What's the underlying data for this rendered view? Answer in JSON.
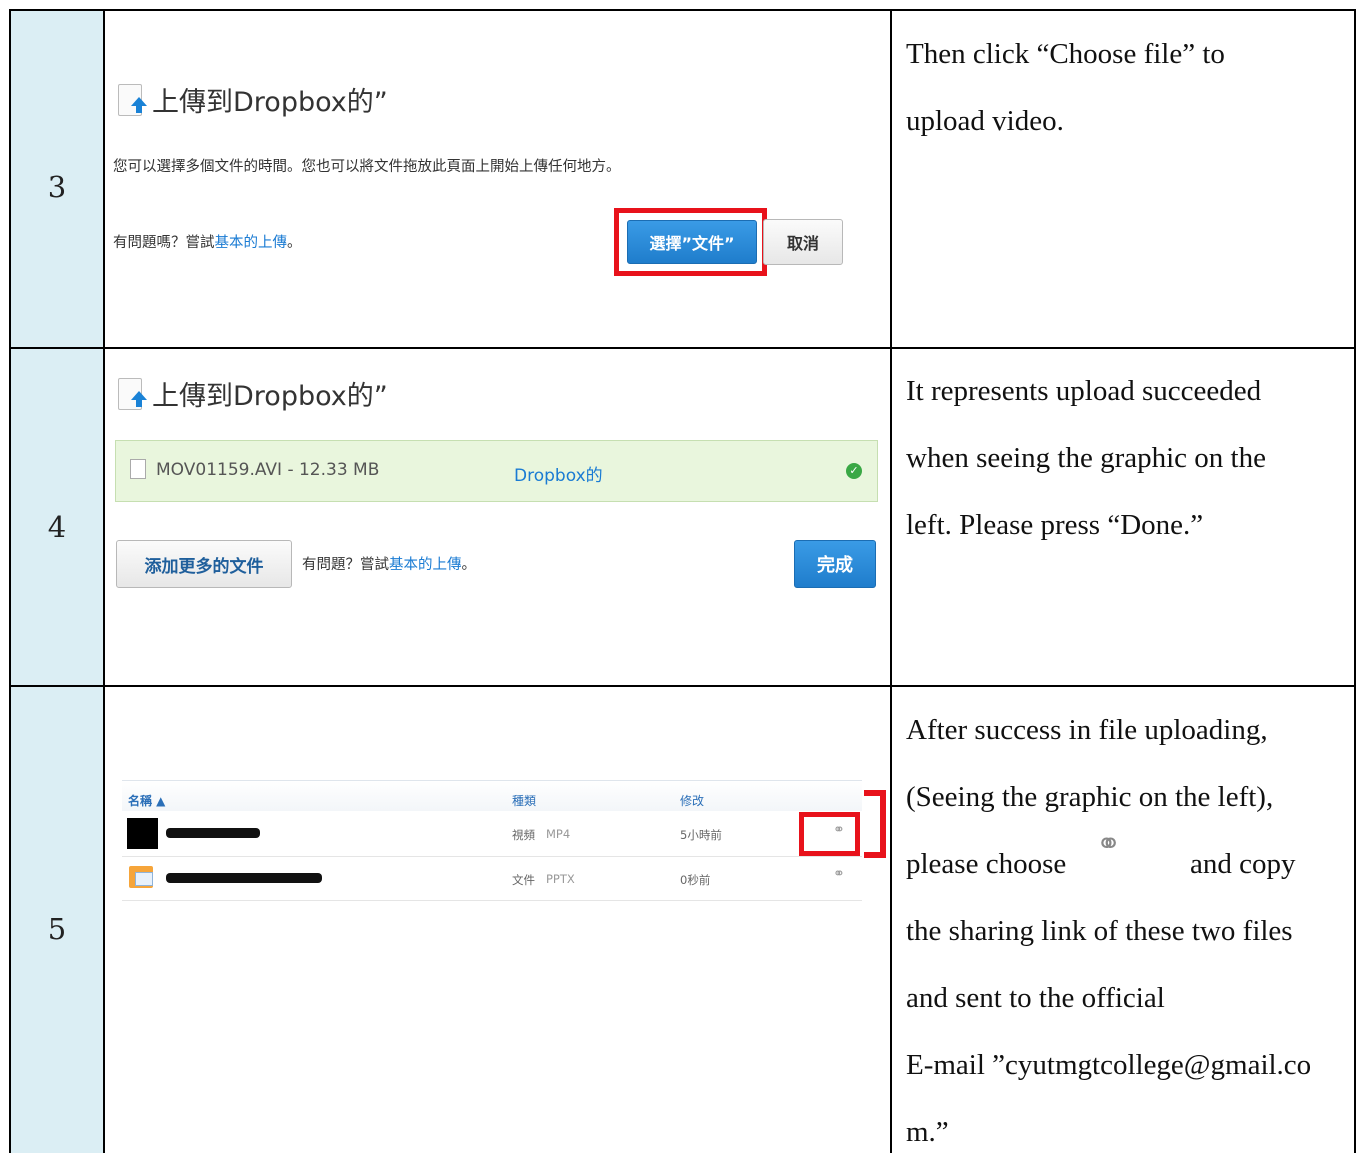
{
  "rows": [
    {
      "step": "3",
      "description": [
        "Then click “Choose file” to",
        "upload video."
      ],
      "dialog": {
        "title": "上傳到Dropbox的”",
        "message": "您可以選擇多個文件的時間。您也可以將文件拖放此頁面上開始上傳任何地方。",
        "help_prefix": "有問題嗎？嘗試",
        "help_link": "基本的上傳",
        "help_suffix": "。",
        "choose_label": "選擇”文件”",
        "cancel_label": "取消"
      }
    },
    {
      "step": "4",
      "description": [
        "It represents upload succeeded",
        "when seeing the graphic on the",
        "left. Please press “Done.”"
      ],
      "dialog": {
        "title": "上傳到Dropbox的”",
        "file_name": "MOV01159.AVI - 12.33 MB",
        "destination": "Dropbox的",
        "add_more_label": "添加更多的文件",
        "help_prefix": "有問題？嘗試",
        "help_link": "基本的上傳",
        "help_suffix": "。",
        "done_label": "完成"
      }
    },
    {
      "step": "5",
      "description_lines": {
        "l1": "After success in file uploading,",
        "l2": "(Seeing the graphic on the left),",
        "l3a": "please choose",
        "l3b": "and copy",
        "l4": "the sharing link of these two files",
        "l5": "and sent to the official",
        "l6": "E-mail ”cyutmgtcollege@gmail.co",
        "l7": "m.”"
      },
      "file_list": {
        "header_name": "名稱 ▲",
        "header_kind": "種類",
        "header_modified": "修改",
        "files": [
          {
            "kind": "視頻",
            "ext": "MP4",
            "modified": "5小時前"
          },
          {
            "kind": "文件",
            "ext": "PPTX",
            "modified": "0秒前"
          }
        ]
      }
    }
  ],
  "icons": {
    "link": "paperclip-link-icon",
    "file": "upload-file-icon",
    "check": "check-circle-icon"
  },
  "colors": {
    "step_bg": "#dbeef4",
    "highlight": "#e8121b",
    "button_blue": "#1f7dcc"
  }
}
